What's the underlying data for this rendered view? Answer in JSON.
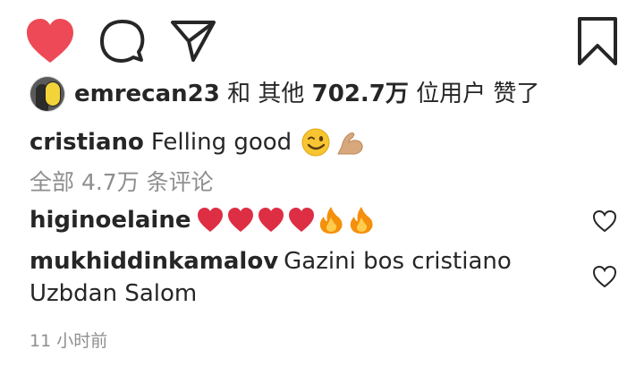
{
  "actions": {
    "like_icon": "heart-filled-icon",
    "comment_icon": "comment-icon",
    "share_icon": "paper-plane-icon",
    "save_icon": "bookmark-icon",
    "like_color": "#ed4956"
  },
  "likes": {
    "username": "emrecan23",
    "and_text": "和 其他",
    "count": "702.7万",
    "suffix": "位用户 赞了"
  },
  "caption": {
    "username": "cristiano",
    "text": "Felling good",
    "emojis": [
      "winking-face",
      "flexed-biceps"
    ]
  },
  "view_all_comments": "全部 4.7万 条评论",
  "comments": [
    {
      "username": "higinoelaine",
      "text": "",
      "emojis": [
        "red-heart",
        "red-heart",
        "red-heart",
        "red-heart",
        "fire",
        "fire"
      ]
    },
    {
      "username": "mukhiddinkamalov",
      "text": "Gazini bos cristiano Uzbdan Salom"
    }
  ],
  "timestamp": "11 小时前",
  "colors": {
    "text": "#262626",
    "secondary": "#8e8e8e",
    "heart_red": "#ed4956"
  }
}
